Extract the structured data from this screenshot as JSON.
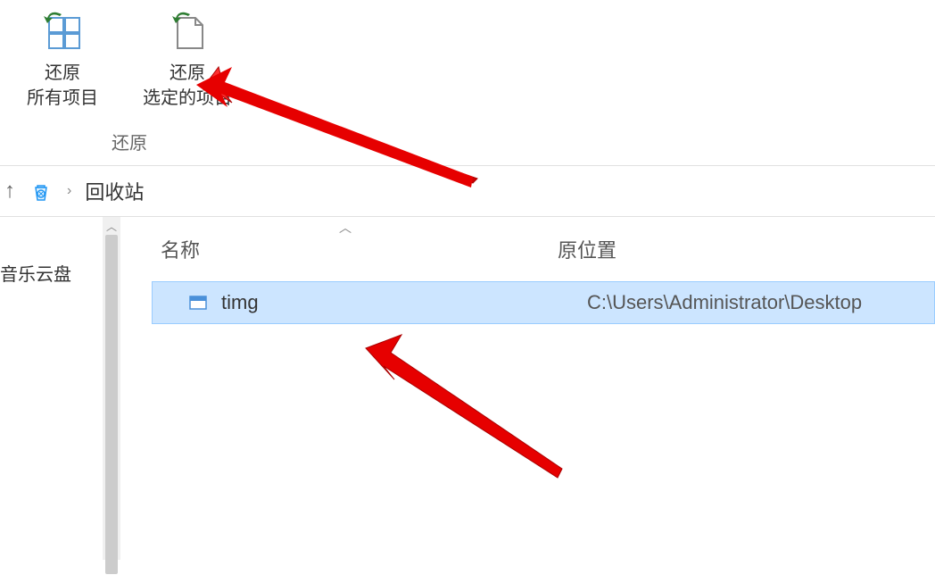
{
  "ribbon": {
    "restore_all": {
      "line1": "还原",
      "line2": "所有项目"
    },
    "restore_selected": {
      "line1": "还原",
      "line2": "选定的项目"
    },
    "group_label": "还原"
  },
  "breadcrumb": {
    "location": "回收站"
  },
  "sidebar": {
    "item_music_cloud": "音乐云盘"
  },
  "columns": {
    "name": "名称",
    "original_location": "原位置"
  },
  "files": [
    {
      "name": "timg",
      "original_location": "C:\\Users\\Administrator\\Desktop"
    }
  ]
}
